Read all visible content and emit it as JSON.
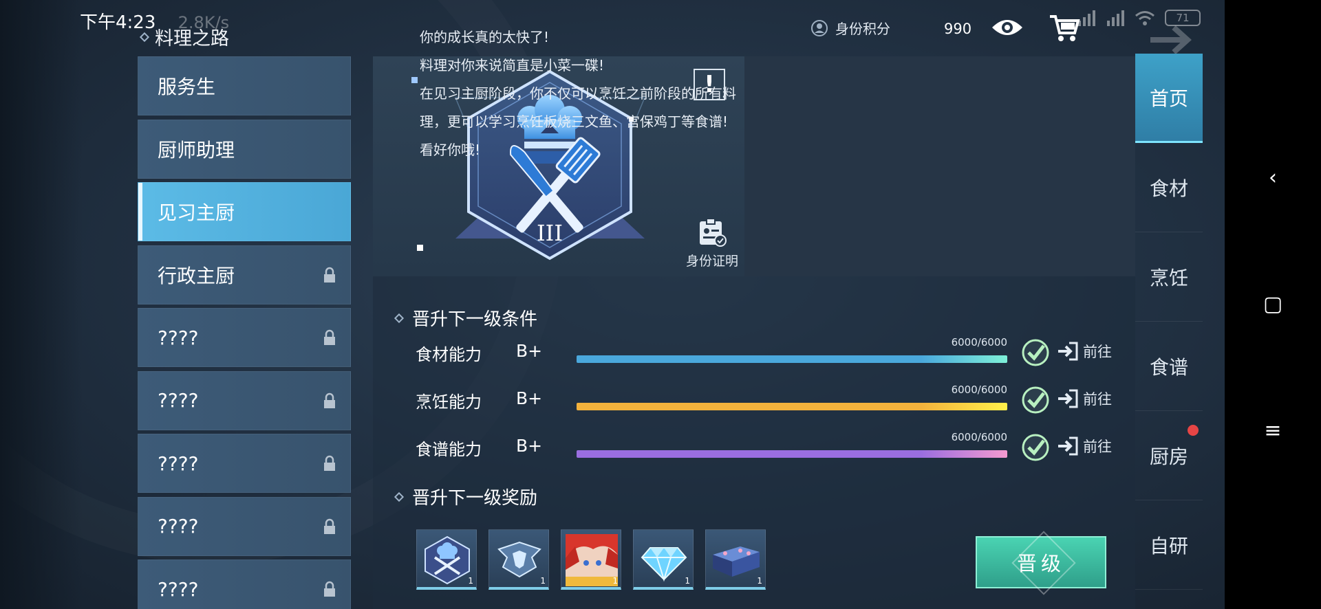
{
  "status_bar": {
    "time": "下午4:23",
    "speed": "2.8K/s",
    "battery": "71"
  },
  "header": {
    "title": "料理之路",
    "identity_label": "身份积分",
    "identity_score": "990"
  },
  "ranks": [
    {
      "label": "服务生",
      "state": "unlocked"
    },
    {
      "label": "厨师助理",
      "state": "unlocked"
    },
    {
      "label": "见习主厨",
      "state": "active"
    },
    {
      "label": "行政主厨",
      "state": "locked"
    },
    {
      "label": "????",
      "state": "locked"
    },
    {
      "label": "????",
      "state": "locked"
    },
    {
      "label": "????",
      "state": "locked"
    },
    {
      "label": "????",
      "state": "locked"
    },
    {
      "label": "????",
      "state": "locked"
    }
  ],
  "badge": {
    "numeral": "III",
    "id_card_label": "身份证明",
    "exclaim": "!"
  },
  "description": [
    "你的成长真的太快了!",
    "料理对你来说简直是小菜一碟!",
    "在见习主厨阶段，你不仅可以烹饪之前阶段的所有料理，更可以学习烹饪板烧三文鱼、宫保鸡丁等食谱!",
    "看好你哦!"
  ],
  "conditions": {
    "title": "晋升下一级条件",
    "go_label": "前往",
    "items": [
      {
        "label": "食材能力",
        "grade": "B+",
        "value": "6000/6000",
        "progress": 1.0,
        "color_start": "#4aa8dc",
        "color_end": "#7ef0d8"
      },
      {
        "label": "烹饪能力",
        "grade": "B+",
        "value": "6000/6000",
        "progress": 1.0,
        "color_start": "#f3b23c",
        "color_end": "#fff04a"
      },
      {
        "label": "食谱能力",
        "grade": "B+",
        "value": "6000/6000",
        "progress": 1.0,
        "color_start": "#9a6ee0",
        "color_end": "#f59ad0"
      }
    ]
  },
  "rewards": {
    "title": "晋升下一级奖励",
    "items": [
      {
        "icon": "chef-badge-icon",
        "count": "1"
      },
      {
        "icon": "emblem-icon",
        "count": "1"
      },
      {
        "icon": "character-portrait-icon",
        "count": "1"
      },
      {
        "icon": "diamond-icon",
        "count": "1"
      },
      {
        "icon": "bento-box-icon",
        "count": "1"
      }
    ]
  },
  "upgrade_button": "晋级",
  "tabs": [
    {
      "label": "首页",
      "active": true,
      "dot": false
    },
    {
      "label": "食材",
      "active": false,
      "dot": false
    },
    {
      "label": "烹饪",
      "active": false,
      "dot": false
    },
    {
      "label": "食谱",
      "active": false,
      "dot": false
    },
    {
      "label": "厨房",
      "active": false,
      "dot": true
    },
    {
      "label": "自研",
      "active": false,
      "dot": false
    }
  ],
  "android_nav": {
    "back": "‹",
    "home": "▢",
    "menu": "≡"
  }
}
